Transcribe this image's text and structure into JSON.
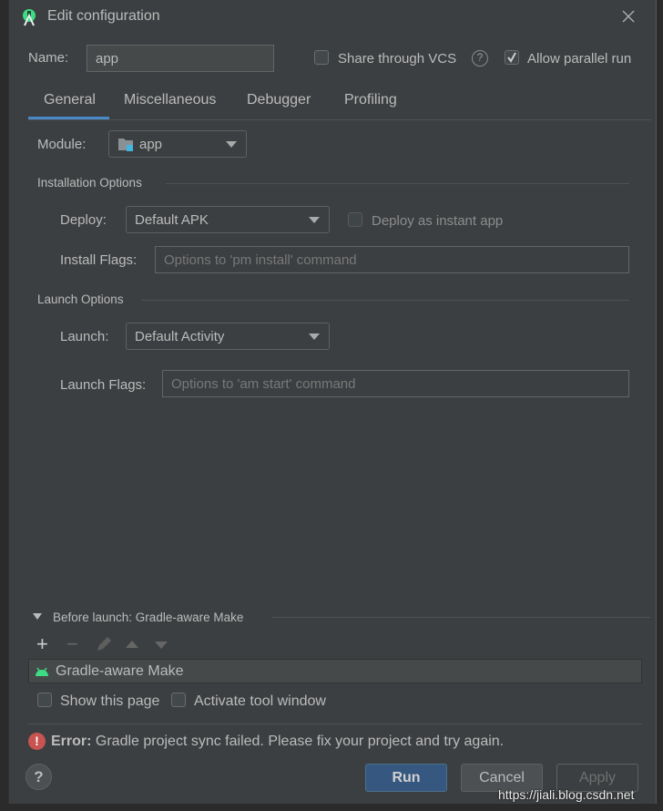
{
  "title": "Edit configuration",
  "name": {
    "label": "Name:",
    "value": "app"
  },
  "share_vcs": {
    "label": "Share through VCS",
    "checked": false
  },
  "allow_parallel": {
    "label": "Allow parallel run",
    "checked": true
  },
  "tabs": [
    {
      "label": "General",
      "active": true
    },
    {
      "label": "Miscellaneous"
    },
    {
      "label": "Debugger"
    },
    {
      "label": "Profiling"
    }
  ],
  "module": {
    "label": "Module:",
    "value": "app"
  },
  "installation": {
    "title": "Installation Options",
    "deploy_label": "Deploy:",
    "deploy_value": "Default APK",
    "instant_label": "Deploy as instant app",
    "flags_label": "Install Flags:",
    "flags_placeholder": "Options to 'pm install' command"
  },
  "launch": {
    "title": "Launch Options",
    "launch_label": "Launch:",
    "launch_value": "Default Activity",
    "flags_label": "Launch Flags:",
    "flags_placeholder": "Options to 'am start' command"
  },
  "before_launch": {
    "title": "Before launch: Gradle-aware Make",
    "items": [
      "Gradle-aware Make"
    ],
    "show_page": "Show this page",
    "activate_tool": "Activate tool window"
  },
  "error": {
    "prefix": "Error:",
    "message": " Gradle project sync failed. Please fix your project and try again.",
    "color": "#c75450"
  },
  "buttons": {
    "run": "Run",
    "cancel": "Cancel",
    "apply": "Apply"
  },
  "watermark": "https://jiali.blog.csdn.net",
  "colors": {
    "accent": "#4a88c7",
    "android": "#3ddc84"
  }
}
